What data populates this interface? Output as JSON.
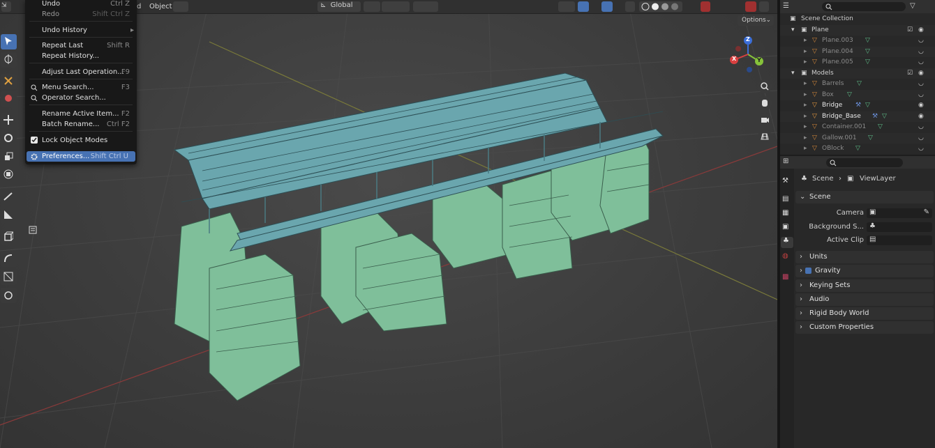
{
  "header": {
    "object_menu": "Object",
    "transform_orientation": "Global",
    "menu_partial": "d",
    "options_label": "Options"
  },
  "edit_menu": {
    "items": [
      {
        "label": "Undo",
        "shortcut": "Ctrl Z"
      },
      {
        "label": "Redo",
        "shortcut": "Shift Ctrl Z"
      },
      {
        "label": "Undo History",
        "shortcut": "▸"
      },
      {
        "label": "Repeat Last",
        "shortcut": "Shift R"
      },
      {
        "label": "Repeat History...",
        "shortcut": ""
      },
      {
        "label": "Adjust Last Operation...",
        "shortcut": "F9"
      },
      {
        "label": "Menu Search...",
        "shortcut": "F3"
      },
      {
        "label": "Operator Search...",
        "shortcut": ""
      },
      {
        "label": "Rename Active Item...",
        "shortcut": "F2"
      },
      {
        "label": "Batch Rename...",
        "shortcut": "Ctrl F2"
      },
      {
        "label": "Lock Object Modes",
        "shortcut": ""
      },
      {
        "label": "Preferences...",
        "shortcut": "Shift Ctrl U"
      }
    ]
  },
  "gizmo": {
    "z": "Z",
    "y": "Y",
    "x": "X"
  },
  "outliner": {
    "root": "Scene Collection",
    "rows": [
      {
        "label": "Plane",
        "type": "collection"
      },
      {
        "label": "Plane.003",
        "type": "object"
      },
      {
        "label": "Plane.004",
        "type": "object"
      },
      {
        "label": "Plane.005",
        "type": "object"
      },
      {
        "label": "Models",
        "type": "collection"
      },
      {
        "label": "Barrels",
        "type": "object"
      },
      {
        "label": "Box",
        "type": "object"
      },
      {
        "label": "Bridge",
        "type": "object"
      },
      {
        "label": "Bridge_Base",
        "type": "object"
      },
      {
        "label": "Container.001",
        "type": "object"
      },
      {
        "label": "Gallow.001",
        "type": "object"
      },
      {
        "label": "OBlock",
        "type": "object"
      }
    ]
  },
  "properties": {
    "breadcrumb_scene": "Scene",
    "breadcrumb_layer": "ViewLayer",
    "scene_panel": "Scene",
    "camera_label": "Camera",
    "background_label": "Background S...",
    "clip_label": "Active Clip",
    "panels": [
      "Units",
      "Gravity",
      "Keying Sets",
      "Audio",
      "Rigid Body World",
      "Custom Properties"
    ]
  },
  "colors": {
    "accent": "#4772b3",
    "mesh": "#7fbf9a",
    "menu_bg": "#181818"
  }
}
